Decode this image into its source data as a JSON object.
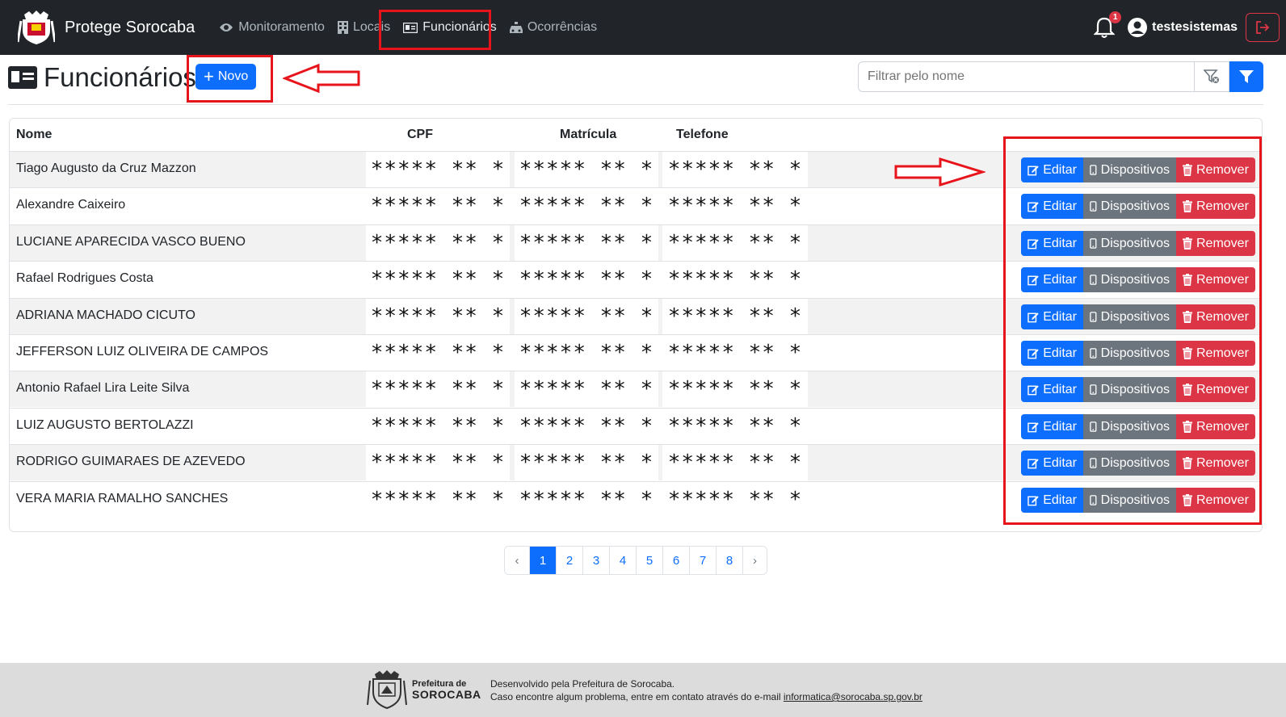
{
  "app": {
    "name": "Protege Sorocaba"
  },
  "nav": {
    "items": [
      {
        "label": "Monitoramento",
        "icon": "eye-icon"
      },
      {
        "label": "Locais",
        "icon": "building-icon"
      },
      {
        "label": "Funcionários",
        "icon": "id-card-icon",
        "active": true
      },
      {
        "label": "Ocorrências",
        "icon": "car-icon"
      }
    ],
    "notifications_count": "1",
    "username": "testesistemas"
  },
  "page": {
    "title": "Funcionários",
    "new_button": "Novo",
    "filter_placeholder": "Filtrar pelo nome"
  },
  "table": {
    "columns": [
      "Nome",
      "CPF",
      "Matrícula",
      "Telefone"
    ],
    "masked_value": "***** ** *",
    "actions": {
      "edit": "Editar",
      "devices": "Dispositivos",
      "remove": "Remover"
    },
    "rows": [
      {
        "name": "Tiago Augusto da Cruz Mazzon"
      },
      {
        "name": "Alexandre Caixeiro"
      },
      {
        "name": "LUCIANE APARECIDA VASCO BUENO"
      },
      {
        "name": "Rafael Rodrigues Costa"
      },
      {
        "name": "ADRIANA MACHADO CICUTO"
      },
      {
        "name": "JEFFERSON LUIZ OLIVEIRA DE CAMPOS"
      },
      {
        "name": "Antonio Rafael Lira Leite Silva"
      },
      {
        "name": "LUIZ AUGUSTO BERTOLAZZI"
      },
      {
        "name": "RODRIGO GUIMARAES DE AZEVEDO"
      },
      {
        "name": "VERA MARIA RAMALHO SANCHES"
      }
    ]
  },
  "pagination": {
    "prev": "‹",
    "pages": [
      "1",
      "2",
      "3",
      "4",
      "5",
      "6",
      "7",
      "8"
    ],
    "current": "1",
    "next": "›"
  },
  "footer": {
    "logo_line1": "Prefeitura de",
    "logo_line2": "SOROCABA",
    "line1": "Desenvolvido pela Prefeitura de Sorocaba.",
    "line2_prefix": "Caso encontre algum problema, entre em contato através do e-mail",
    "email": "informatica@sorocaba.sp.gov.br"
  },
  "colors": {
    "primary": "#0d6efd",
    "secondary": "#6c757d",
    "danger": "#dc3545",
    "navbar": "#212529",
    "highlight": "#e8141b"
  }
}
